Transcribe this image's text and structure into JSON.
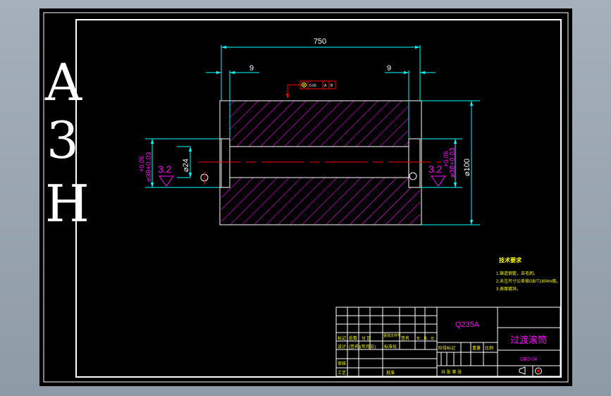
{
  "sheet_code": [
    "A",
    "3",
    "H"
  ],
  "dimensions": {
    "overall_length": "750",
    "left_recess": "9",
    "right_recess": "9",
    "left_bore_tol_upper": "+0.05",
    "left_bore_diameter": "⌀38+0.03",
    "right_bore_tol_upper": "+0.05",
    "right_bore_diameter": "⌀38+0.03",
    "inner_diameter": "⌀24",
    "outer_diameter": "⌀100",
    "roughness_left": "3.2",
    "roughness_right": "3.2"
  },
  "tolerance_frame": [
    "0",
    "0.05",
    "A",
    "B"
  ],
  "notes": {
    "title": "技术要求",
    "items": [
      "1.铸造钢管，去毛刺。",
      "2.未注尺寸公差按GB/T1804m级。",
      "3.表面镀锌。"
    ]
  },
  "title_block": {
    "material": "Q235A",
    "part_name": "过渡滚筒",
    "drawing_no": "GBJ-04",
    "cells": {
      "mark": "标记",
      "count": "处数",
      "zone": "分 区",
      "change_doc": "更改文件号",
      "signature": "签名",
      "date": "年、月、日",
      "design": "设计",
      "standardize_sig": "(签名)",
      "date2": "(年月日)",
      "standardize": "标准化",
      "stage_mark": "阶段标记",
      "weight": "重量",
      "scale": "比例",
      "review": "审核",
      "process": "工艺",
      "approve": "批准",
      "sheets": "共  张  第  张"
    }
  },
  "colors": {
    "background": "#000000",
    "outline": "#ffffff",
    "hatch": "#ff00ff",
    "dimension": "#00ffff",
    "centerline": "#ff0000",
    "text_dim": "#ffffff",
    "text_notes": "#ffff00",
    "text_title": "#ff00ff"
  }
}
